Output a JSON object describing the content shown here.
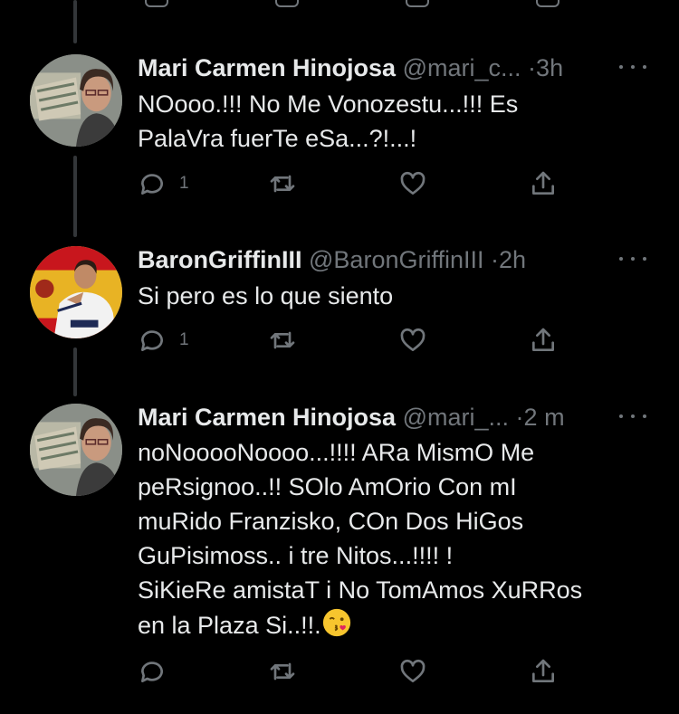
{
  "tweets": [
    {
      "name": "Mari Carmen Hinojosa",
      "handle": "@mari_c...",
      "dot": "·",
      "time": "3h",
      "text": "NOooo.!!! No Me Vonozestu...!!! Es\nPalaVra fuerTe eSa...?!...!",
      "reply_count": "1",
      "retweet_count": "",
      "like_count": ""
    },
    {
      "name": "BaronGriffinIII",
      "handle": "@BaronGriffinIII",
      "dot": "·",
      "time": "2h",
      "text": "Si pero es lo que siento",
      "reply_count": "1",
      "retweet_count": "",
      "like_count": ""
    },
    {
      "name": "Mari Carmen Hinojosa",
      "handle": "@mari_...",
      "dot": "·",
      "time": "2 m",
      "text": "noNooooNoooo...!!!! ARa MismO Me\npeRsignoo..!! SOlo AmOrio Con mI\nmuRido Franzisko, COn Dos HiGos\nGuPisimoss.. i tre Nitos...!!!! !\nSiKieRe amistaT i No TomAmos XuRRos\nen la Plaza Si..!!.",
      "emoji": "face-blowing-a-kiss",
      "reply_count": "",
      "retweet_count": "",
      "like_count": ""
    }
  ],
  "icons": [
    "reply-icon",
    "retweet-icon",
    "like-icon",
    "share-icon",
    "more-icon"
  ],
  "colors": {
    "background": "#000000",
    "text": "#e7e9ea",
    "muted": "#71767b",
    "thread_line": "#333639"
  }
}
